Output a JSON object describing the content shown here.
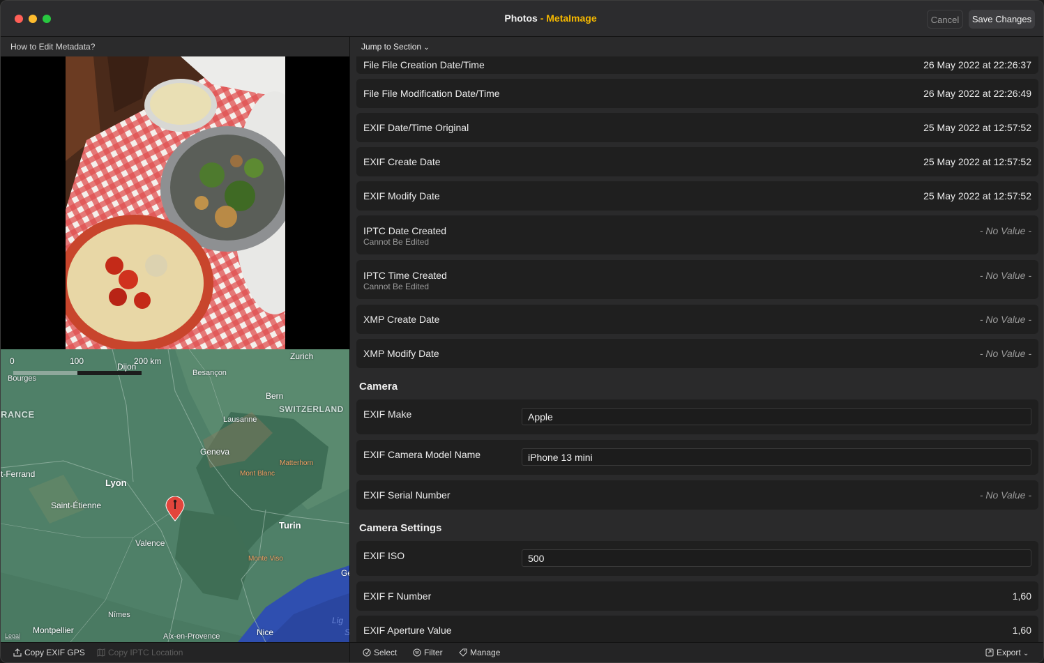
{
  "window": {
    "title_app": "Photos",
    "title_sep": " - ",
    "title_doc": "MetaImage",
    "cancel_label": "Cancel",
    "save_label": "Save Changes"
  },
  "left": {
    "help_link": "How to Edit Metadata?",
    "map": {
      "scale_labels": [
        "0",
        "100",
        "200 km"
      ],
      "cities": [
        "Zurich",
        "Dijon",
        "Besançon",
        "Bourges",
        "Bern",
        "SWITZERLAND",
        "RANCE",
        "Lausanne",
        "Geneva",
        "Matterhorn",
        "Mont Blanc",
        "t-Ferrand",
        "Lyon",
        "Saint-Étienne",
        "Turin",
        "Valence",
        "Monte Viso",
        "Ge",
        "Nîmes",
        "Montpellier",
        "Aix-en-Provence",
        "Nice",
        "Lig",
        "S"
      ],
      "legal": "Legal"
    },
    "footer": {
      "copy_gps": "Copy EXIF GPS",
      "copy_iptc": "Copy IPTC Location"
    }
  },
  "right": {
    "jump_label": "Jump to Section",
    "rows": [
      {
        "label": "File File Creation Date/Time",
        "value": "26 May 2022 at 22:26:37"
      },
      {
        "label": "File File Modification Date/Time",
        "value": "26 May 2022 at 22:26:49"
      },
      {
        "label": "EXIF Date/Time Original",
        "value": "25 May 2022 at 12:57:52"
      },
      {
        "label": "EXIF Create Date",
        "value": "25 May 2022 at 12:57:52"
      },
      {
        "label": "EXIF Modify Date",
        "value": "25 May 2022 at 12:57:52"
      },
      {
        "label": "IPTC Date Created",
        "sub": "Cannot Be Edited",
        "value": "- No Value -"
      },
      {
        "label": "IPTC Time Created",
        "sub": "Cannot Be Edited",
        "value": "- No Value -"
      },
      {
        "label": "XMP Create Date",
        "value": "- No Value -"
      },
      {
        "label": "XMP Modify Date",
        "value": "- No Value -"
      }
    ],
    "section_camera": "Camera",
    "camera": [
      {
        "label": "EXIF Make",
        "value": "Apple"
      },
      {
        "label": "EXIF Camera Model Name",
        "value": "iPhone 13 mini"
      },
      {
        "label": "EXIF Serial Number",
        "value": "- No Value -"
      }
    ],
    "section_settings": "Camera Settings",
    "settings": [
      {
        "label": "EXIF ISO",
        "value": "500"
      },
      {
        "label": "EXIF F Number",
        "value": "1,60"
      },
      {
        "label": "EXIF Aperture Value",
        "value": "1,60"
      }
    ],
    "footer": {
      "select": "Select",
      "filter": "Filter",
      "manage": "Manage",
      "export": "Export"
    }
  }
}
